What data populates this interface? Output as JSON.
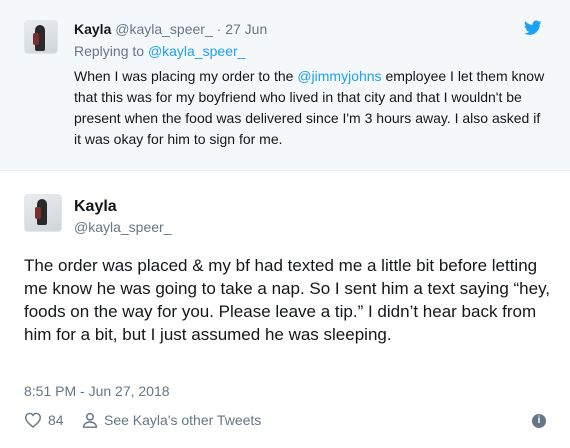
{
  "reply_tweet": {
    "name": "Kayla",
    "handle": "@kayla_speer_",
    "separator": "·",
    "date": "27 Jun",
    "replying_prefix": "Replying to",
    "replying_handle": "@kayla_speer_",
    "text_before_mention": "When I was placing my order to the ",
    "mention": "@jimmyjohns",
    "text_after_mention": " employee I let them know that this was for my boyfriend who lived in that city and that I wouldn't be present when the food was delivered since I'm 3 hours away. I also asked if it was okay for him to sign for me."
  },
  "main_tweet": {
    "name": "Kayla",
    "handle": "@kayla_speer_",
    "text": "The order was placed & my bf had texted me a little bit before letting me know he was going to take a nap. So I sent him a text saying “hey, foods on the way for you. Please leave a tip.” I didn’t hear back from him for a bit, but I just assumed he was sleeping.",
    "timestamp": "8:51 PM - Jun 27, 2018",
    "likes": "84",
    "other_tweets_label": "See Kayla's other Tweets"
  },
  "icons": {
    "brand": "twitter-bird-icon",
    "like": "heart-icon",
    "profile": "person-icon",
    "info": "info-icon"
  },
  "colors": {
    "link": "#1da1f2",
    "muted": "#657786",
    "reply_bg": "#f5f8fa"
  }
}
